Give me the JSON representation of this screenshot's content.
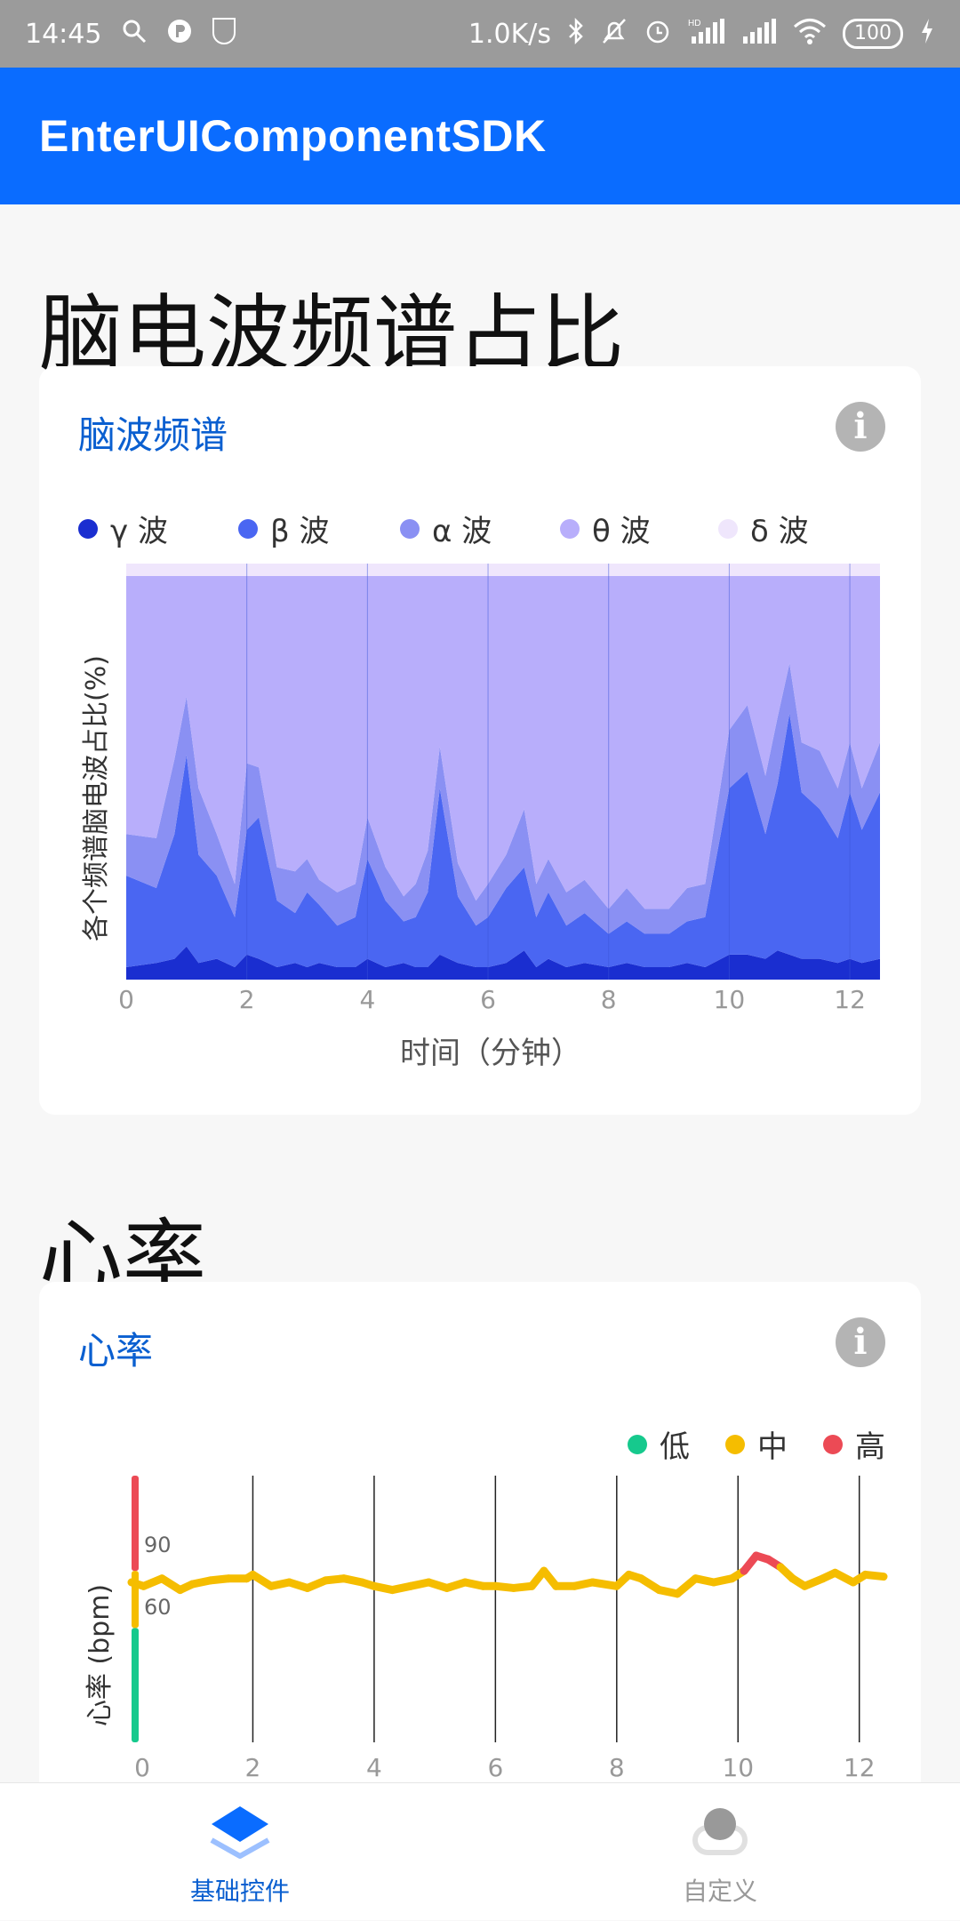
{
  "status_bar": {
    "time": "14:45",
    "network_speed": "1.0K/s",
    "battery": "100",
    "icons": [
      "search-icon",
      "parking-icon",
      "badge-icon",
      "bluetooth-icon",
      "mute-icon",
      "alarm-icon",
      "hd-signal-icon",
      "signal-icon",
      "wifi-icon",
      "charging-icon"
    ]
  },
  "app_bar": {
    "title": "EnterUIComponentSDK"
  },
  "colors": {
    "primary": "#0a6cff",
    "gamma": "#1a2ed0",
    "beta": "#4a66f2",
    "alpha": "#8a90f3",
    "theta": "#b8aefb",
    "delta": "#efe6fc",
    "hr_low": "#16c98d",
    "hr_mid": "#f5bd00",
    "hr_high": "#ec4a55"
  },
  "eeg_section": {
    "title": "脑电波频谱占比",
    "card_title": "脑波频谱",
    "info_icon": "info-icon",
    "info_glyph": "i",
    "legend": [
      {
        "label": "γ 波",
        "color": "#1a2ed0"
      },
      {
        "label": "β 波",
        "color": "#4a66f2"
      },
      {
        "label": "α 波",
        "color": "#8a90f3"
      },
      {
        "label": "θ 波",
        "color": "#b8aefb"
      },
      {
        "label": "δ 波",
        "color": "#efe6fc"
      }
    ],
    "ylabel": "各个频谱脑电波占比(%)",
    "xlabel": "时间（分钟）",
    "x_ticks": [
      "0",
      "2",
      "4",
      "6",
      "8",
      "10",
      "12"
    ]
  },
  "hr_section": {
    "title": "心率",
    "card_title": "心率",
    "info_icon": "info-icon",
    "info_glyph": "i",
    "legend": [
      {
        "label": "低",
        "color": "#16c98d"
      },
      {
        "label": "中",
        "color": "#f5bd00"
      },
      {
        "label": "高",
        "color": "#ec4a55"
      }
    ],
    "ylabel": "心率 (bpm)",
    "y_ticks": [
      "90",
      "60"
    ],
    "x_ticks": [
      "0",
      "2",
      "4",
      "6",
      "8",
      "10",
      "12"
    ]
  },
  "bottom_nav": {
    "items": [
      {
        "label": "基础控件",
        "icon": "layers-icon",
        "active": true
      },
      {
        "label": "自定义",
        "icon": "toggle-icon",
        "active": false
      }
    ]
  },
  "chart_data": [
    {
      "type": "area",
      "stacked": true,
      "x_range": [
        0,
        12.5
      ],
      "ylim": [
        0,
        100
      ],
      "xlabel": "时间（分钟）",
      "ylabel": "各个频谱脑电波占比(%)",
      "x_ticks": [
        0,
        2,
        4,
        6,
        8,
        10,
        12
      ],
      "legend_position": "top",
      "x": [
        0,
        0.5,
        0.8,
        1.0,
        1.2,
        1.5,
        1.8,
        2.0,
        2.2,
        2.5,
        2.8,
        3.0,
        3.2,
        3.5,
        3.8,
        4.0,
        4.3,
        4.6,
        4.8,
        5.0,
        5.2,
        5.5,
        5.8,
        6.0,
        6.3,
        6.6,
        6.8,
        7.0,
        7.3,
        7.6,
        8.0,
        8.3,
        8.6,
        9.0,
        9.3,
        9.6,
        10.0,
        10.3,
        10.6,
        10.8,
        11.0,
        11.2,
        11.5,
        11.8,
        12.0,
        12.2,
        12.5
      ],
      "series": [
        {
          "name": "δ 波",
          "values": [
            3,
            4,
            5,
            8,
            4,
            5,
            3,
            6,
            5,
            3,
            4,
            3,
            4,
            3,
            3,
            5,
            3,
            4,
            3,
            3,
            6,
            4,
            3,
            3,
            4,
            7,
            3,
            5,
            3,
            4,
            3,
            4,
            3,
            3,
            4,
            3,
            6,
            6,
            5,
            7,
            6,
            5,
            5,
            4,
            5,
            4,
            5
          ]
        },
        {
          "name": "θ 波",
          "values": [
            22,
            18,
            30,
            46,
            26,
            20,
            12,
            30,
            34,
            16,
            12,
            18,
            14,
            10,
            12,
            24,
            16,
            10,
            12,
            18,
            40,
            16,
            10,
            12,
            18,
            20,
            12,
            16,
            10,
            12,
            8,
            10,
            8,
            8,
            10,
            12,
            40,
            44,
            30,
            40,
            58,
            40,
            36,
            30,
            40,
            32,
            40
          ]
        },
        {
          "name": "α 波",
          "values": [
            10,
            12,
            18,
            14,
            16,
            10,
            8,
            16,
            12,
            8,
            10,
            8,
            6,
            8,
            8,
            10,
            8,
            6,
            8,
            10,
            10,
            8,
            6,
            8,
            8,
            14,
            8,
            8,
            8,
            8,
            6,
            8,
            6,
            6,
            8,
            8,
            14,
            16,
            14,
            16,
            12,
            12,
            14,
            12,
            12,
            10,
            12
          ]
        },
        {
          "name": "β 波",
          "values": [
            62,
            63,
            44,
            29,
            51,
            62,
            74,
            45,
            46,
            70,
            71,
            68,
            73,
            76,
            74,
            58,
            70,
            77,
            74,
            66,
            41,
            69,
            78,
            74,
            67,
            56,
            74,
            68,
            76,
            73,
            80,
            75,
            80,
            80,
            75,
            74,
            37,
            31,
            48,
            34,
            21,
            40,
            42,
            51,
            40,
            51,
            40
          ]
        },
        {
          "name": "γ 波",
          "values": [
            3,
            3,
            3,
            3,
            3,
            3,
            3,
            3,
            3,
            3,
            3,
            3,
            3,
            3,
            3,
            3,
            3,
            3,
            3,
            3,
            3,
            3,
            3,
            3,
            3,
            3,
            3,
            3,
            3,
            3,
            3,
            3,
            3,
            3,
            3,
            3,
            3,
            3,
            3,
            3,
            3,
            3,
            3,
            3,
            3,
            3,
            3
          ]
        }
      ]
    },
    {
      "type": "line",
      "x_range": [
        0,
        12.4
      ],
      "ylim": [
        0,
        140
      ],
      "ylabel": "心率 (bpm)",
      "y_ticks": [
        90,
        60
      ],
      "x_ticks": [
        0,
        2,
        4,
        6,
        8,
        10,
        12
      ],
      "legend_position": "top-right",
      "zones": {
        "low_max": 60,
        "mid_max": 90
      },
      "x": [
        0,
        0.2,
        0.5,
        0.8,
        1.0,
        1.3,
        1.6,
        1.9,
        2.0,
        2.3,
        2.6,
        2.9,
        3.2,
        3.5,
        3.8,
        4.0,
        4.3,
        4.6,
        4.9,
        5.2,
        5.5,
        5.8,
        6.0,
        6.3,
        6.6,
        6.8,
        7.0,
        7.3,
        7.6,
        8.0,
        8.2,
        8.4,
        8.7,
        9.0,
        9.3,
        9.6,
        9.9,
        10.1,
        10.3,
        10.5,
        10.7,
        10.9,
        11.1,
        11.4,
        11.6,
        11.9,
        12.1,
        12.4
      ],
      "values": [
        84,
        82,
        86,
        80,
        83,
        85,
        86,
        86,
        88,
        82,
        84,
        81,
        85,
        86,
        84,
        82,
        80,
        82,
        84,
        81,
        84,
        82,
        82,
        81,
        82,
        90,
        82,
        82,
        84,
        82,
        88,
        86,
        80,
        78,
        86,
        84,
        86,
        90,
        98,
        96,
        92,
        86,
        82,
        86,
        89,
        84,
        88,
        87
      ]
    }
  ]
}
